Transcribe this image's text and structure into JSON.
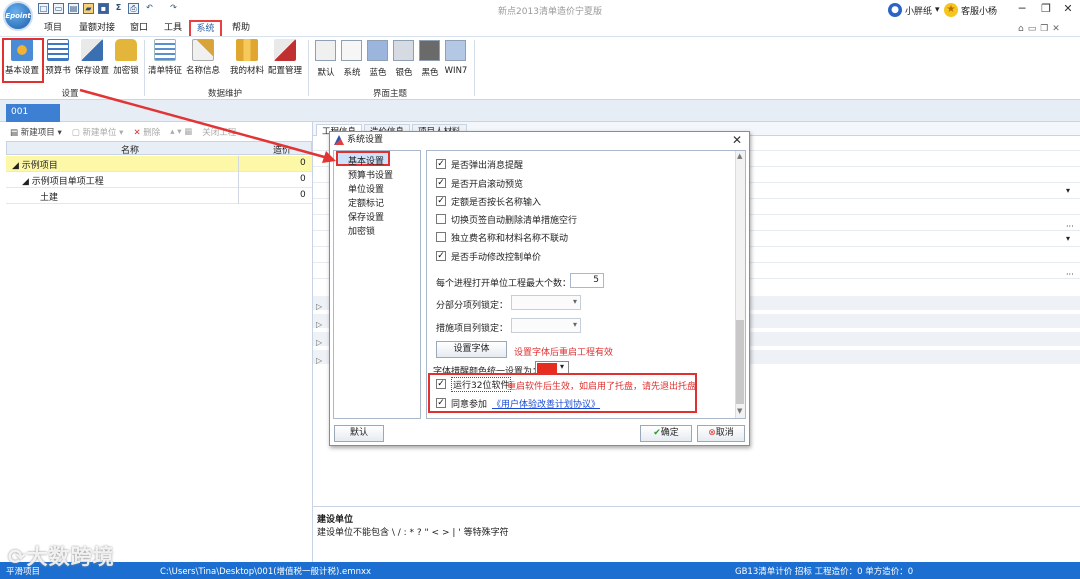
{
  "app": {
    "title": "新点2013清单造价宁夏版",
    "logo": "Epoint",
    "user1": "小胖纸",
    "user2": "客服小杨"
  },
  "quick_access": [
    "new-icon",
    "open-icon",
    "save-icon",
    "sum-icon",
    "print-icon",
    "undo-icon",
    "redo-icon"
  ],
  "menu": [
    "项目",
    "量额对接",
    "窗口",
    "工具",
    "系统",
    "帮助"
  ],
  "ribbon": {
    "settings": [
      "基本设置",
      "预算书",
      "保存设置",
      "加密锁"
    ],
    "settings_group": "设置",
    "maintain": [
      "清单特征",
      "名称信息",
      "我的材料",
      "配置管理"
    ],
    "maintain_group": "数据维护",
    "themes": [
      "默认",
      "系统",
      "蓝色",
      "银色",
      "黑色",
      "WIN7"
    ],
    "themes_group": "界面主题",
    "theme_colors": [
      "#f0f0f0",
      "#f6f6f6",
      "#9bb5dc",
      "#d6dbe3",
      "#6a6a6a",
      "#b4c8e6"
    ]
  },
  "doc_tab": "001",
  "left_toolbar": {
    "new_project": "新建项目",
    "new_unit": "新建单位",
    "delete": "删除",
    "close": "关闭工程"
  },
  "grid": {
    "col_name": "名称",
    "col_price": "造价",
    "rows": [
      {
        "name": "示例项目",
        "value": "0"
      },
      {
        "name": "示例项目单项工程",
        "value": "0"
      },
      {
        "name": "土建",
        "value": "0"
      }
    ]
  },
  "right_tabs": [
    "工程信息",
    "造价信息",
    "项目人材料"
  ],
  "bottom": {
    "heading": "建设单位",
    "desc": "建设单位不能包含 \\ / : * ? \" < > | ' 等特殊字符"
  },
  "dialog": {
    "title": "系统设置",
    "nav": [
      "基本设置",
      "预算书设置",
      "单位设置",
      "定额标记",
      "保存设置",
      "加密锁"
    ],
    "options": [
      {
        "label": "是否弹出消息提醒",
        "checked": true
      },
      {
        "label": "是否开启滚动预览",
        "checked": true
      },
      {
        "label": "定额是否按长名称输入",
        "checked": true
      },
      {
        "label": "切换页签自动删除清单措施空行",
        "checked": false
      },
      {
        "label": "独立费名称和材料名称不联动",
        "checked": false
      },
      {
        "label": "是否手动修改控制单价",
        "checked": true
      }
    ],
    "max_open_label": "每个进程打开单位工程最大个数：",
    "max_open_value": "5",
    "fenbu_lock_label": "分部分项列锁定：",
    "cuoshi_lock_label": "措施项目列锁定：",
    "font_button": "设置字体",
    "font_note": "设置字体后重启工程有效",
    "color_label": "字体措醒颜色统一设置为：",
    "color_value": "#e52e1f",
    "run32_label": "运行32位软件",
    "run32_note": "重启软件后生效，如启用了托盘，请先退出托盘",
    "agree_label": "同意参加",
    "agree_link": "《用户体验改善计划协议》",
    "default_btn": "默认",
    "ok_btn": "确定",
    "cancel_btn": "取消"
  },
  "status": {
    "left": "平滑项目",
    "path": "C:\\Users\\Tina\\Desktop\\001(增值税一般计税).emnxx",
    "right": "GB13清单计价  招标  工程造价：0  单方造价：0"
  },
  "watermark": "大数跨境"
}
